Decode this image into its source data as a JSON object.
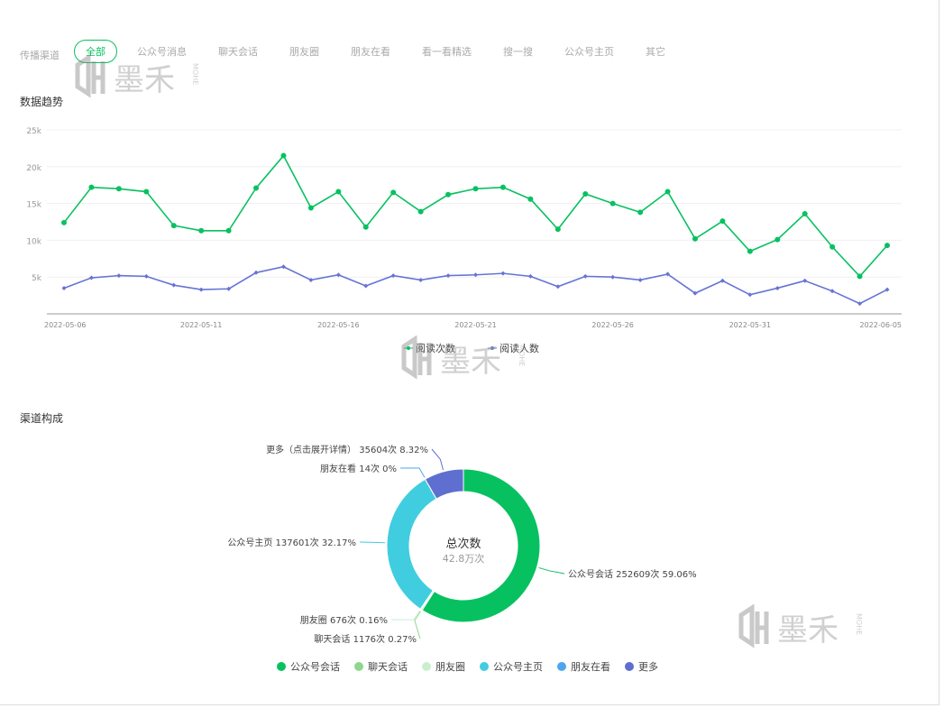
{
  "filter": {
    "label": "传播渠道",
    "tabs": [
      "全部",
      "公众号消息",
      "聊天会话",
      "朋友圈",
      "朋友在看",
      "看一看精选",
      "搜一搜",
      "公众号主页",
      "其它"
    ],
    "active": 0
  },
  "watermark": {
    "text": "墨禾",
    "sub": "MOHE"
  },
  "trend": {
    "title": "数据趋势"
  },
  "composition": {
    "title": "渠道构成",
    "center_title": "总次数",
    "center_value": "42.8万次"
  },
  "colors": {
    "green": "#07c160",
    "blue": "#6674d4"
  },
  "chart_data": [
    {
      "type": "line",
      "title": "数据趋势",
      "ylim": [
        0,
        25000
      ],
      "yticks": [
        "5k",
        "10k",
        "15k",
        "20k",
        "25k"
      ],
      "ytick_values": [
        5000,
        10000,
        15000,
        20000,
        25000
      ],
      "xtick_labels": [
        "2022-05-06",
        "2022-05-11",
        "2022-05-16",
        "2022-05-21",
        "2022-05-26",
        "2022-05-31",
        "2022-06-05"
      ],
      "xtick_index": [
        0,
        5,
        10,
        15,
        20,
        25,
        30
      ],
      "x": [
        "05-06",
        "05-07",
        "05-08",
        "05-09",
        "05-10",
        "05-11",
        "05-12",
        "05-13",
        "05-14",
        "05-15",
        "05-16",
        "05-17",
        "05-18",
        "05-19",
        "05-20",
        "05-21",
        "05-22",
        "05-23",
        "05-24",
        "05-25",
        "05-26",
        "05-27",
        "05-28",
        "05-29",
        "05-30",
        "05-31",
        "06-01",
        "06-02",
        "06-03",
        "06-04",
        "06-05"
      ],
      "series": [
        {
          "name": "阅读次数",
          "color": "#07c160",
          "values": [
            12400,
            17200,
            17000,
            16600,
            12000,
            11300,
            11300,
            17100,
            21500,
            14400,
            16600,
            11800,
            16500,
            13900,
            16200,
            17000,
            17200,
            15600,
            11500,
            16300,
            15000,
            13800,
            16600,
            10200,
            12600,
            8500,
            10100,
            13600,
            9100,
            5100,
            9300
          ]
        },
        {
          "name": "阅读人数",
          "color": "#6674d4",
          "values": [
            3500,
            4900,
            5200,
            5100,
            3900,
            3300,
            3400,
            5600,
            6400,
            4600,
            5300,
            3800,
            5200,
            4600,
            5200,
            5300,
            5500,
            5100,
            3700,
            5100,
            5000,
            4600,
            5400,
            2800,
            4500,
            2600,
            3500,
            4500,
            3100,
            1400,
            3300
          ]
        }
      ],
      "legend": "bottom"
    },
    {
      "type": "pie",
      "title": "渠道构成",
      "donut": true,
      "slices": [
        {
          "name": "公众号会话",
          "value": 252609,
          "percent": "59.06%",
          "label": "公众号会话 252609次 59.06%",
          "color": "#07c160"
        },
        {
          "name": "聊天会话",
          "value": 1176,
          "percent": "0.27%",
          "label": "聊天会话 1176次 0.27%",
          "color": "#8fd68f"
        },
        {
          "name": "朋友圈",
          "value": 676,
          "percent": "0.16%",
          "label": "朋友圈 676次 0.16%",
          "color": "#c9efd0"
        },
        {
          "name": "公众号主页",
          "value": 137601,
          "percent": "32.17%",
          "label": "公众号主页 137601次 32.17%",
          "color": "#40cde0"
        },
        {
          "name": "朋友在看",
          "value": 14,
          "percent": "0%",
          "label": "朋友在看 14次 0%",
          "color": "#4ea5ee"
        },
        {
          "name": "更多",
          "value": 35604,
          "percent": "8.32%",
          "label": "更多（点击展开详情） 35604次 8.32%",
          "color": "#5e6fd0"
        }
      ],
      "legend": "bottom"
    }
  ]
}
